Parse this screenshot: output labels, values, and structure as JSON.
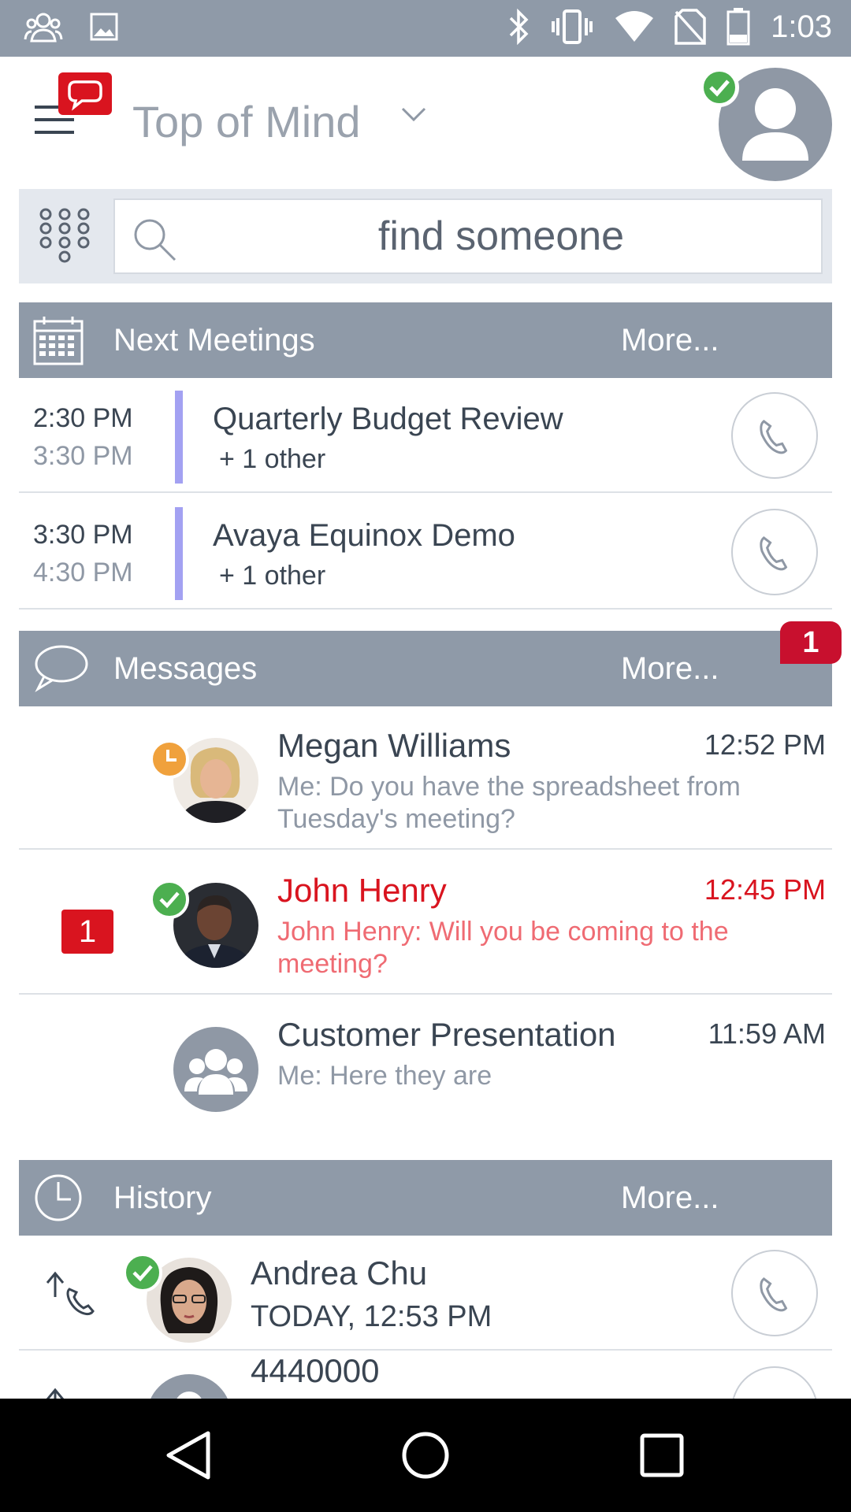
{
  "status_bar": {
    "time": "1:03",
    "icons": [
      "group-icon",
      "image-icon",
      "bluetooth-icon",
      "vibrate-icon",
      "wifi-icon",
      "no-sim-icon",
      "battery-icon"
    ]
  },
  "header": {
    "title": "Top of Mind",
    "chat_badge_color": "#d9141f",
    "presence": "available"
  },
  "search": {
    "placeholder": "find someone"
  },
  "meetings": {
    "title": "Next Meetings",
    "more": "More...",
    "items": [
      {
        "start": "2:30 PM",
        "end": "3:30 PM",
        "title": "Quarterly Budget Review",
        "others": "+ 1 other"
      },
      {
        "start": "3:30 PM",
        "end": "4:30 PM",
        "title": "Avaya Equinox Demo",
        "others": "+ 1 other"
      }
    ]
  },
  "messages": {
    "title": "Messages",
    "more": "More...",
    "badge": "1",
    "items": [
      {
        "name": "Megan Williams",
        "time": "12:52 PM",
        "text": "Me: Do you have the spreadsheet from Tuesday's meeting?",
        "presence": "away",
        "unread": ""
      },
      {
        "name": "John Henry",
        "time": "12:45 PM",
        "text": "John Henry: Will you be coming to the meeting?",
        "presence": "available",
        "unread": "1"
      },
      {
        "name": "Customer Presentation",
        "time": "11:59 AM",
        "text": "Me: Here they are",
        "presence": "",
        "unread": ""
      }
    ]
  },
  "history": {
    "title": "History",
    "more": "More...",
    "items": [
      {
        "name": "Andrea Chu",
        "time": "TODAY, 12:53 PM",
        "presence": "available"
      },
      {
        "name": "4440000",
        "time": ""
      }
    ]
  },
  "colors": {
    "section_header": "#8f9aa8",
    "accent_red": "#d9141f",
    "presence_green": "#4caf50",
    "presence_away": "#f0a13c",
    "meeting_bar": "#a3a1f2"
  }
}
